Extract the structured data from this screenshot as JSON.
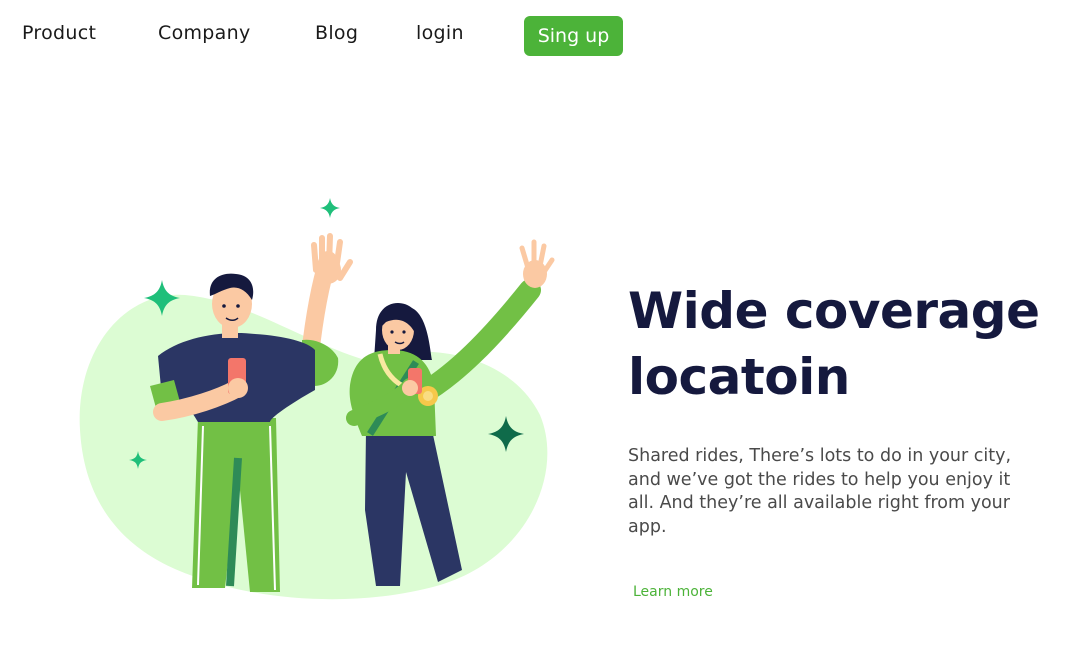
{
  "nav": {
    "links": [
      "Product",
      "Company",
      "Blog",
      "login"
    ],
    "signup_label": "Sing up"
  },
  "hero": {
    "headline_line1": "Wide coverage",
    "headline_line2": "locatoin",
    "description": "Shared rides, There’s lots to do in your city, and we’ve got the rides to help you enjoy it all. And they’re all available right from your app.",
    "cta_label": "Learn more"
  },
  "colors": {
    "accent": "#4cb339",
    "headline": "#15193e",
    "blob": "#dcfcd3",
    "sparkle": "#1fbf7a",
    "sparkle_dark": "#0f6b4a",
    "navy": "#2b3664",
    "shirt_green": "#72c045",
    "skin": "#fbc9a3",
    "hair": "#15193e"
  },
  "icons": [
    "sparkle-icon"
  ]
}
